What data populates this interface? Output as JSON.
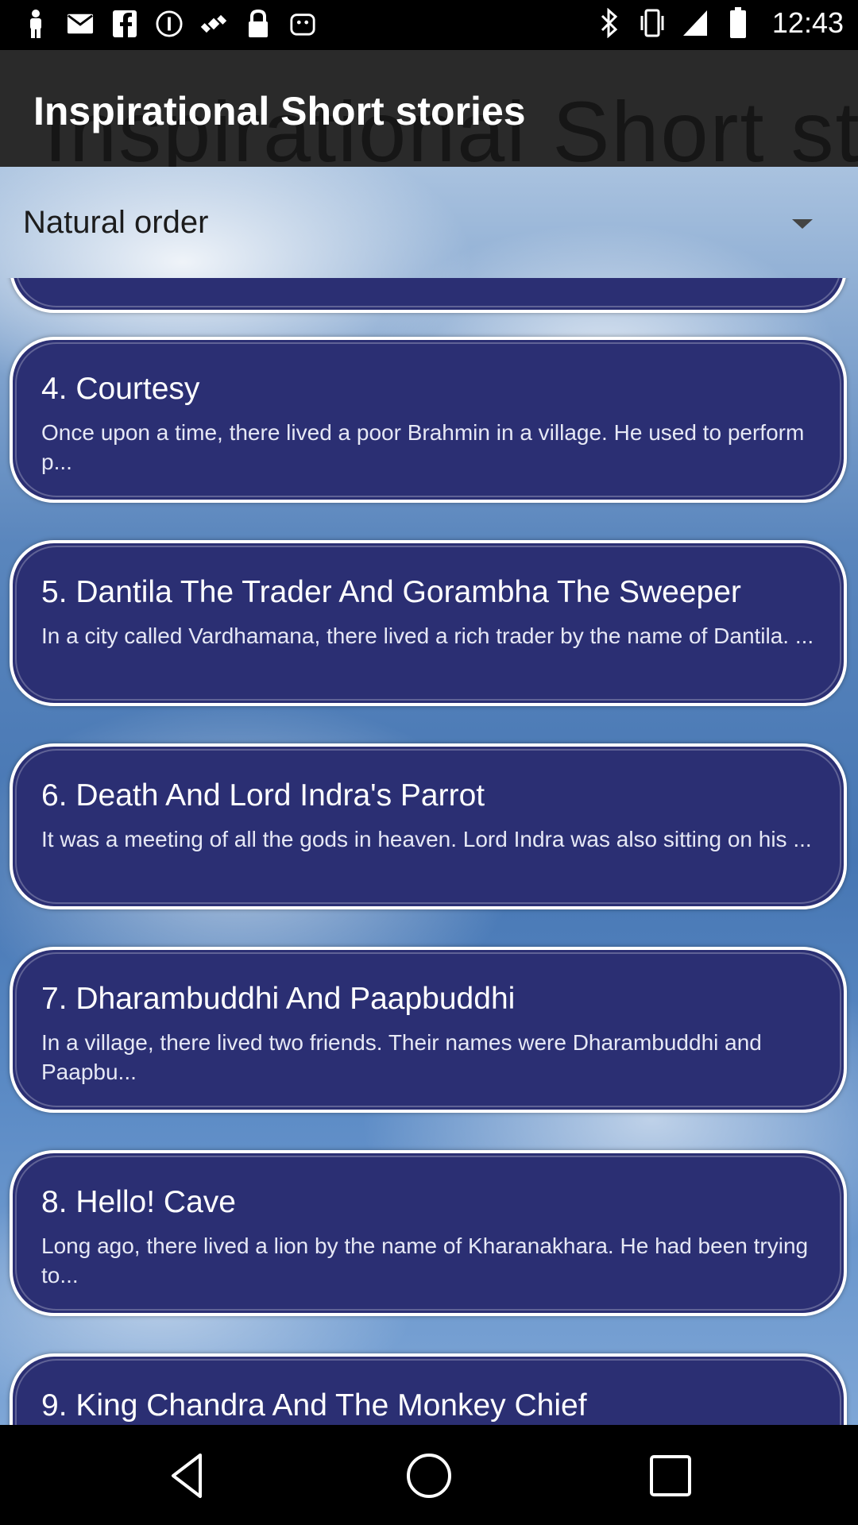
{
  "status_bar": {
    "time": "12:43",
    "left_icons": [
      "person-icon",
      "mail-icon",
      "facebook-icon",
      "info-icon",
      "satellite-icon",
      "lock-icon",
      "android-icon"
    ],
    "right_icons": [
      "bluetooth-icon",
      "vibrate-icon",
      "signal-icon",
      "battery-icon"
    ]
  },
  "app_bar": {
    "title": "Inspirational Short stories",
    "background_text": "Inspirational Short stories"
  },
  "sort": {
    "selected": "Natural order"
  },
  "stories": [
    {
      "title": "",
      "desc": ""
    },
    {
      "title": "4. Courtesy",
      "desc": " Once upon a time, there lived a poor Brahmin in a village. He used to perform p..."
    },
    {
      "title": "5. Dantila The Trader And Gorambha The Sweeper",
      "desc": " In a city called Vardhamana, there lived a rich trader by the name of Dantila. ..."
    },
    {
      "title": "6. Death And Lord Indra's Parrot",
      "desc": " It was a meeting of all the gods in heaven. Lord Indra was also sitting on his ..."
    },
    {
      "title": "7. Dharambuddhi And Paapbuddhi",
      "desc": " In a village, there lived two friends. Their names were Dharambuddhi and Paapbu..."
    },
    {
      "title": "8. Hello! Cave",
      "desc": " Long ago, there lived a lion by the name of Kharanakhara. He had been trying to..."
    },
    {
      "title": "9. King Chandra And The Monkey Chief",
      "desc": ""
    }
  ],
  "colors": {
    "card_bg": "#2b2f73",
    "app_bar_bg": "#2a2a2a"
  },
  "nav_bar": [
    "back-icon",
    "home-icon",
    "recents-icon"
  ]
}
